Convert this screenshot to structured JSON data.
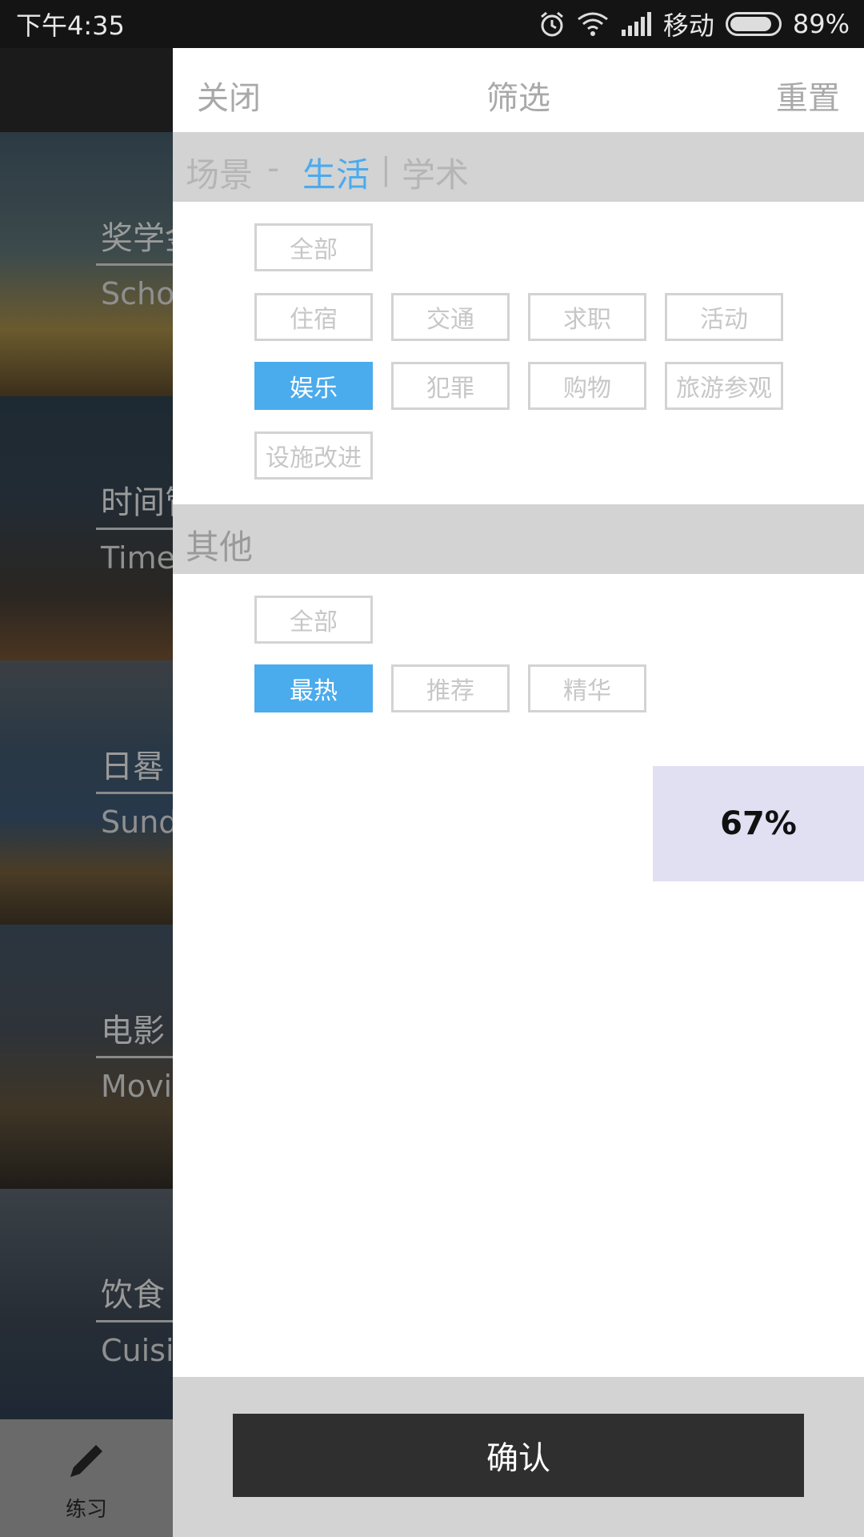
{
  "status_bar": {
    "time": "下午4:35",
    "carrier": "移动",
    "battery": "89%",
    "icons": [
      "alarm-icon",
      "wifi-icon",
      "signal-icon",
      "battery-icon"
    ]
  },
  "background_list": {
    "cards": [
      {
        "title": "奖学金",
        "subtitle": "Scholarship"
      },
      {
        "title": "时间管理",
        "subtitle": "Time management"
      },
      {
        "title": "日晷",
        "subtitle": "Sundial"
      },
      {
        "title": "电影",
        "subtitle": "Movies"
      },
      {
        "title": "饮食",
        "subtitle": "Cuisine"
      }
    ],
    "tab_label": "练习"
  },
  "filter": {
    "close_label": "关闭",
    "title": "筛选",
    "reset_label": "重置",
    "scene_label": "场景",
    "scene_separator": "-",
    "scene_tab_life": "生活",
    "scene_tab_divider": "|",
    "scene_tab_academic": "学术",
    "scene_tags": [
      "全部",
      "住宿",
      "交通",
      "求职",
      "活动",
      "娱乐",
      "犯罪",
      "购物",
      "旅游参观",
      "设施改进"
    ],
    "scene_selected": "娱乐",
    "other_label": "其他",
    "other_tags": [
      "全部",
      "最热",
      "推荐",
      "精华"
    ],
    "other_selected": "最热",
    "progress": "67%",
    "confirm_label": "确认"
  },
  "colors": {
    "accent": "#4aabed",
    "section_bg": "#d3d3d3",
    "confirm_bg": "#2f2f2f",
    "progress_bg": "#e1dff2"
  }
}
